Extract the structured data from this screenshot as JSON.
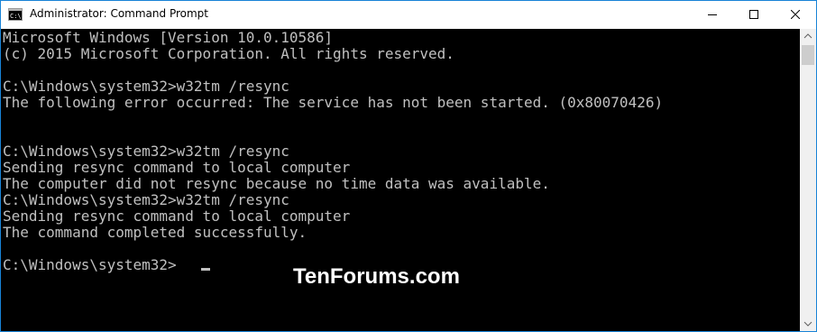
{
  "window": {
    "title": "Administrator: Command Prompt",
    "icon": "command-prompt-icon",
    "controls": [
      "minimize-icon",
      "maximize-icon",
      "close-icon"
    ]
  },
  "console": {
    "lines": [
      "Microsoft Windows [Version 10.0.10586]",
      "(c) 2015 Microsoft Corporation. All rights reserved.",
      "",
      "C:\\Windows\\system32>w32tm /resync",
      "The following error occurred: The service has not been started. (0x80070426)",
      "",
      "C:\\Windows\\system32>w32tm /resync",
      "Sending resync command to local computer",
      "The computer did not resync because no time data was available.",
      "",
      "C:\\Windows\\system32>w32tm /resync",
      "Sending resync command to local computer",
      "The command completed successfully.",
      "",
      "C:\\Windows\\system32>"
    ]
  },
  "watermark": "TenForums.com",
  "colors": {
    "console_background": "#000000",
    "console_text": "#c0c0c0",
    "window_border": "#1883d7"
  }
}
